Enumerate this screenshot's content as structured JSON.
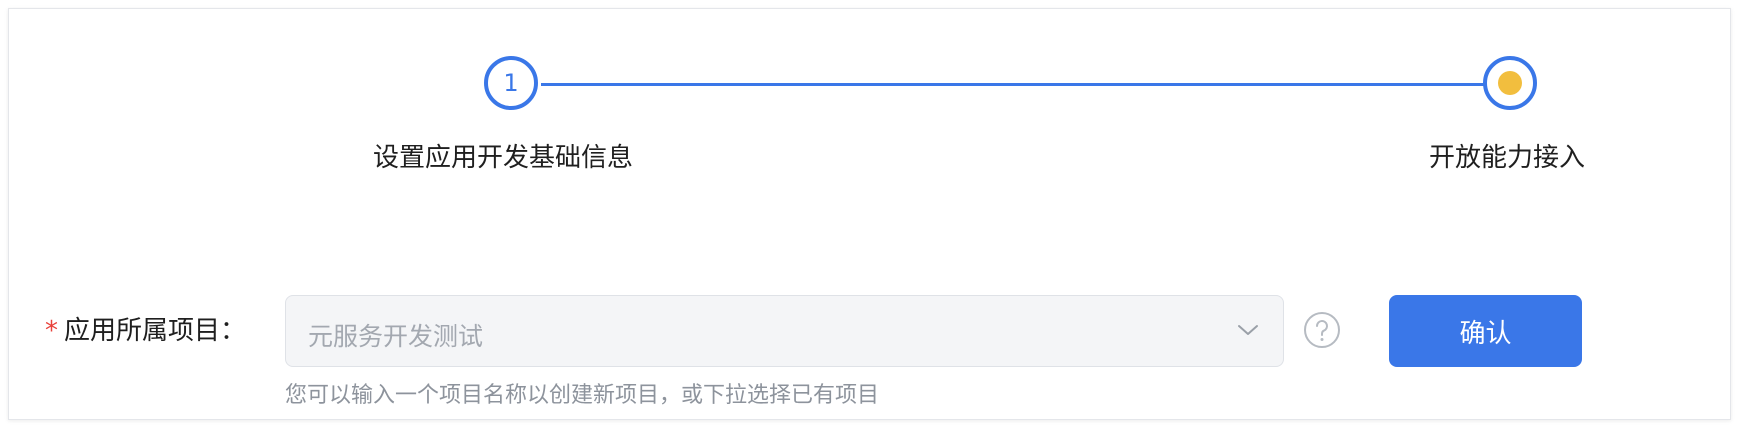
{
  "steps": [
    {
      "number": "1",
      "label": "设置应用开发基础信息",
      "state": "done"
    },
    {
      "number": "",
      "label": "开放能力接入",
      "state": "current"
    }
  ],
  "form": {
    "required_mark": "*",
    "label": "应用所属项目：",
    "select_value": "元服务开发测试",
    "hint": "您可以输入一个项目名称以创建新项目，或下拉选择已有项目",
    "help_icon": "question-circle-icon"
  },
  "actions": {
    "confirm_label": "确认"
  },
  "colors": {
    "accent": "#3a77e8",
    "current_dot": "#f2be3e",
    "required": "#e8413a"
  }
}
